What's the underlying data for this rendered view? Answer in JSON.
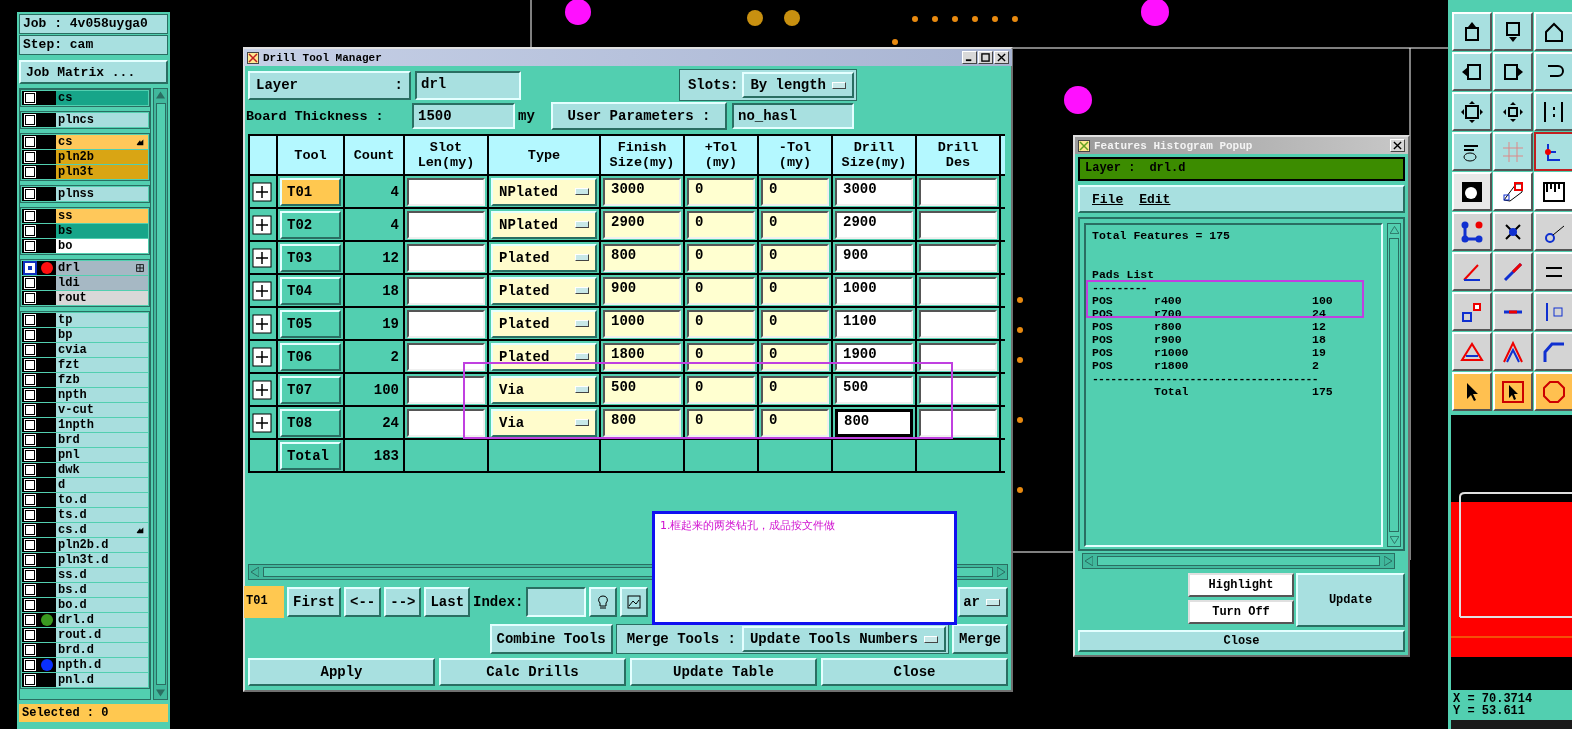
{
  "layer_panel": {
    "job": "Job : 4v058uyga0",
    "step": "Step: cam",
    "matrix_button": "Job Matrix ...",
    "groups": [
      [
        {
          "name": "cs",
          "color": "#17a589",
          "selected": false,
          "hand": false,
          "grid": false
        }
      ],
      [
        {
          "name": "plncs",
          "color": "#a8dede",
          "selected": false,
          "hand": false,
          "grid": false
        }
      ],
      [
        {
          "name": "cs",
          "color": "#ffc85a",
          "selected": false,
          "hand": true,
          "grid": false
        },
        {
          "name": "pln2b",
          "color": "#d9a514",
          "selected": false,
          "hand": false,
          "grid": false
        },
        {
          "name": "pln3t",
          "color": "#d9a514",
          "selected": false,
          "hand": false,
          "grid": false
        }
      ],
      [
        {
          "name": "plnss",
          "color": "#a8dede",
          "selected": false,
          "hand": false,
          "grid": false
        }
      ],
      [
        {
          "name": "ss",
          "color": "#ffc85a",
          "selected": false,
          "hand": false,
          "grid": false
        },
        {
          "name": "bs",
          "color": "#17a589",
          "selected": false,
          "hand": false,
          "grid": false
        },
        {
          "name": "bo",
          "color": "#ffffff",
          "selected": false,
          "hand": false,
          "grid": false
        }
      ],
      [
        {
          "name": "drl",
          "color": "#a6b8c4",
          "selected": true,
          "dot": {
            "color": "#ff1010"
          },
          "hand": false,
          "grid": true
        },
        {
          "name": "ldi",
          "color": "#a6b8c4",
          "selected": false,
          "hand": false,
          "grid": false
        },
        {
          "name": "rout",
          "color": "#d8d8d8",
          "selected": false,
          "hand": false,
          "grid": false
        }
      ],
      [
        {
          "name": "tp",
          "color": "#a8dede",
          "selected": false,
          "hand": false,
          "grid": false
        },
        {
          "name": "bp",
          "color": "#a8dede",
          "selected": false,
          "hand": false,
          "grid": false
        },
        {
          "name": "cvia",
          "color": "#a8dede",
          "selected": false,
          "hand": false,
          "grid": false
        },
        {
          "name": "fzt",
          "color": "#a8dede",
          "selected": false,
          "hand": false,
          "grid": false
        },
        {
          "name": "fzb",
          "color": "#a8dede",
          "selected": false,
          "hand": false,
          "grid": false
        },
        {
          "name": "npth",
          "color": "#a8dede",
          "selected": false,
          "hand": false,
          "grid": false
        },
        {
          "name": "v-cut",
          "color": "#a8dede",
          "selected": false,
          "hand": false,
          "grid": false
        },
        {
          "name": "1npth",
          "color": "#a8dede",
          "selected": false,
          "hand": false,
          "grid": false
        },
        {
          "name": "brd",
          "color": "#a8dede",
          "selected": false,
          "hand": false,
          "grid": false
        },
        {
          "name": "pnl",
          "color": "#a8dede",
          "selected": false,
          "hand": false,
          "grid": false
        },
        {
          "name": "dwk",
          "color": "#a8dede",
          "selected": false,
          "hand": false,
          "grid": false
        },
        {
          "name": "d",
          "color": "#a8dede",
          "selected": false,
          "hand": false,
          "grid": false
        },
        {
          "name": "to.d",
          "color": "#a8dede",
          "selected": false,
          "hand": false,
          "grid": false
        },
        {
          "name": "ts.d",
          "color": "#a8dede",
          "selected": false,
          "hand": false,
          "grid": false
        },
        {
          "name": "cs.d",
          "color": "#a8dede",
          "selected": false,
          "hand": true,
          "grid": false
        },
        {
          "name": "pln2b.d",
          "color": "#a8dede",
          "selected": false,
          "hand": false,
          "grid": false
        },
        {
          "name": "pln3t.d",
          "color": "#a8dede",
          "selected": false,
          "hand": false,
          "grid": false
        },
        {
          "name": "ss.d",
          "color": "#a8dede",
          "selected": false,
          "hand": false,
          "grid": false
        },
        {
          "name": "bs.d",
          "color": "#a8dede",
          "selected": false,
          "hand": false,
          "grid": false
        },
        {
          "name": "bo.d",
          "color": "#a8dede",
          "selected": false,
          "hand": false,
          "grid": false
        },
        {
          "name": "drl.d",
          "color": "#a8dede",
          "selected": false,
          "dot": {
            "color": "#3a9a20"
          },
          "hand": false,
          "grid": false
        },
        {
          "name": "rout.d",
          "color": "#a8dede",
          "selected": false,
          "hand": false,
          "grid": false
        },
        {
          "name": "brd.d",
          "color": "#a8dede",
          "selected": false,
          "hand": false,
          "grid": false
        },
        {
          "name": "npth.d",
          "color": "#a8dede",
          "selected": false,
          "dot": {
            "color": "#0a30ff"
          },
          "hand": false,
          "grid": false
        },
        {
          "name": "pnl.d",
          "color": "#a8dede",
          "selected": false,
          "hand": false,
          "grid": false
        }
      ]
    ],
    "selected_count": "Selected : 0"
  },
  "drill_tool_manager": {
    "title": "Drill Tool Manager",
    "layer_label": "Layer",
    "layer_colon": ":",
    "layer_value": "drl",
    "slots_label": "Slots:",
    "slots_value": "By length",
    "thickness_label": "Board Thickness :",
    "thickness_value": "1500",
    "thickness_unit": "my",
    "user_params_button": "User Parameters :",
    "user_params_value": "no_hasl",
    "columns": [
      "Tool",
      "Count",
      "Slot\nLen(my)",
      "Type",
      "Finish\nSize(my)",
      "+Tol\n(my)",
      "-Tol\n(my)",
      "Drill\nSize(my)",
      "Drill\nDes"
    ],
    "rows": [
      {
        "tool": "T01",
        "count": "4",
        "type": "NPlated",
        "finish": "3000",
        "plus_tol": "0",
        "minus_tol": "0",
        "drill_size": "3000",
        "selected": true,
        "focused": false
      },
      {
        "tool": "T02",
        "count": "4",
        "type": "NPlated",
        "finish": "2900",
        "plus_tol": "0",
        "minus_tol": "0",
        "drill_size": "2900",
        "selected": false,
        "focused": false
      },
      {
        "tool": "T03",
        "count": "12",
        "type": "Plated",
        "finish": "800",
        "plus_tol": "0",
        "minus_tol": "0",
        "drill_size": "900",
        "selected": false,
        "focused": false
      },
      {
        "tool": "T04",
        "count": "18",
        "type": "Plated",
        "finish": "900",
        "plus_tol": "0",
        "minus_tol": "0",
        "drill_size": "1000",
        "selected": false,
        "focused": false
      },
      {
        "tool": "T05",
        "count": "19",
        "type": "Plated",
        "finish": "1000",
        "plus_tol": "0",
        "minus_tol": "0",
        "drill_size": "1100",
        "selected": false,
        "focused": false
      },
      {
        "tool": "T06",
        "count": "2",
        "type": "Plated",
        "finish": "1800",
        "plus_tol": "0",
        "minus_tol": "0",
        "drill_size": "1900",
        "selected": false,
        "focused": false
      },
      {
        "tool": "T07",
        "count": "100",
        "type": "Via",
        "finish": "500",
        "plus_tol": "0",
        "minus_tol": "0",
        "drill_size": "500",
        "selected": false,
        "focused": false
      },
      {
        "tool": "T08",
        "count": "24",
        "type": "Via",
        "finish": "800",
        "plus_tol": "0",
        "minus_tol": "0",
        "drill_size": "800",
        "selected": false,
        "focused": true
      }
    ],
    "total": {
      "label": "Total",
      "count": "183"
    },
    "nav": {
      "current": "T01",
      "buttons": [
        "First",
        "<--",
        "-->",
        "Last"
      ],
      "index_label": "Index:",
      "partial_dropdown": "ar"
    },
    "combine_button": "Combine Tools",
    "merge_label": "Merge Tools :",
    "merge_dropdown": "Update Tools Numbers",
    "merge_button": "Merge",
    "actions": [
      "Apply",
      "Calc Drills",
      "Update Table",
      "Close"
    ]
  },
  "note": {
    "text": "1.框起来的两类钻孔，成品按文件做"
  },
  "histogram": {
    "title": "Features Histogram Popup",
    "layer_label": "Layer :",
    "layer_value": "drl.d",
    "menu": [
      "File",
      "Edit"
    ],
    "total_line": "Total Features = 175",
    "section": "Pads List",
    "underline": "---------",
    "pads": [
      {
        "type": "POS",
        "symbol": "r400",
        "count": "100"
      },
      {
        "type": "POS",
        "symbol": "r700",
        "count": "24"
      },
      {
        "type": "POS",
        "symbol": "r800",
        "count": "12"
      },
      {
        "type": "POS",
        "symbol": "r900",
        "count": "18"
      },
      {
        "type": "POS",
        "symbol": "r1000",
        "count": "19"
      },
      {
        "type": "POS",
        "symbol": "r1800",
        "count": "2"
      }
    ],
    "separator": "-------------------------------------",
    "total": {
      "label": "Total",
      "count": "175"
    },
    "buttons": {
      "highlight": "Highlight",
      "turn_off": "Turn Off",
      "update": "Update",
      "close": "Close"
    }
  },
  "coordinates": {
    "x": "X = 70.3714",
    "y": "Y = 53.611"
  }
}
